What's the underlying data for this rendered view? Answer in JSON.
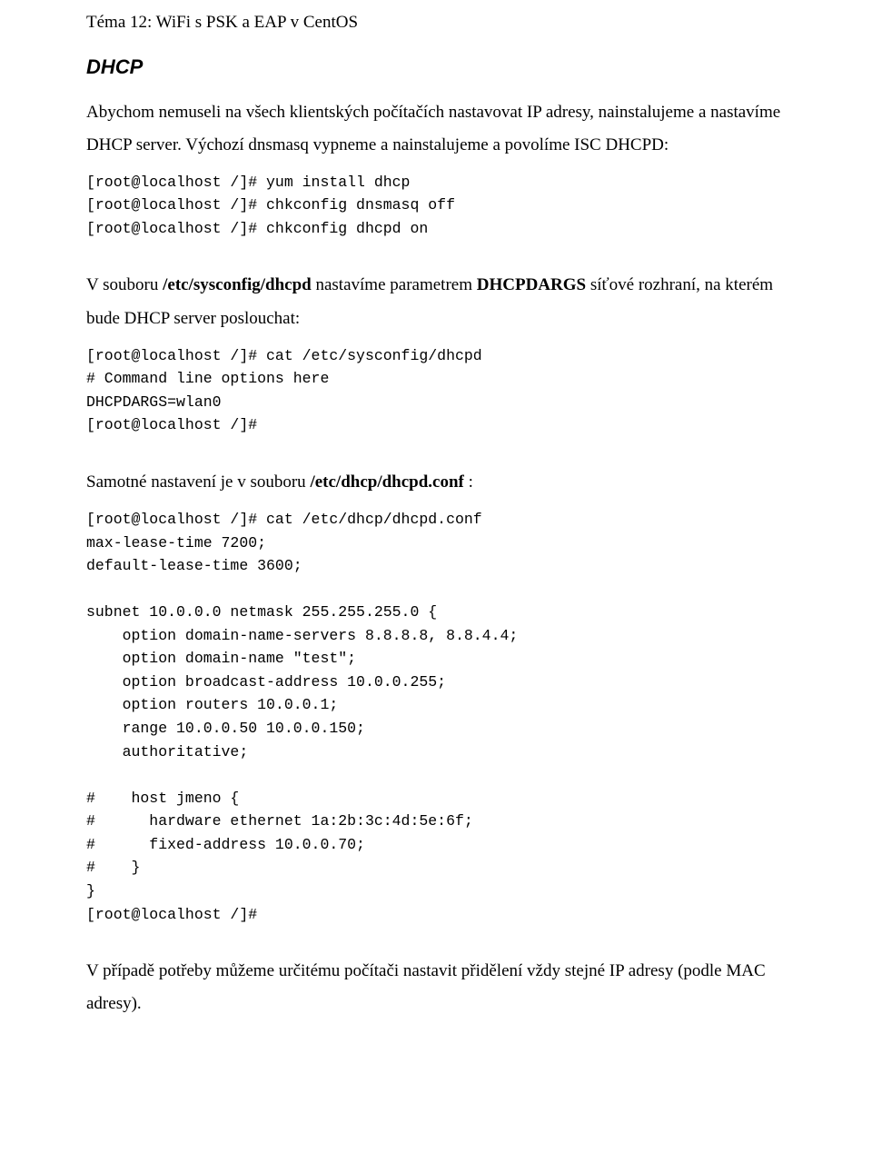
{
  "header": "Téma 12: WiFi s PSK a EAP v CentOS",
  "subtitle": "DHCP",
  "para1": "Abychom nemuseli na všech klientských počítačích nastavovat IP adresy, nainstalujeme a nastavíme DHCP server. Výchozí dnsmasq vypneme a nainstalujeme a povolíme ISC DHCPD:",
  "code1": "[root@localhost /]# yum install dhcp\n[root@localhost /]# chkconfig dnsmasq off\n[root@localhost /]# chkconfig dhcpd on",
  "para2_pre": "V souboru ",
  "para2_bold1": "/etc/sysconfig/dhcpd",
  "para2_mid": " nastavíme parametrem ",
  "para2_bold2": "DHCPDARGS",
  "para2_post": " síťové rozhraní, na kterém bude DHCP server poslouchat:",
  "code2": "[root@localhost /]# cat /etc/sysconfig/dhcpd\n# Command line options here\nDHCPDARGS=wlan0\n[root@localhost /]#",
  "para3_pre": "Samotné nastavení je v souboru ",
  "para3_bold": "/etc/dhcp/dhcpd.conf",
  "para3_post": " :",
  "code3": "[root@localhost /]# cat /etc/dhcp/dhcpd.conf\nmax-lease-time 7200;\ndefault-lease-time 3600;\n\nsubnet 10.0.0.0 netmask 255.255.255.0 {\n    option domain-name-servers 8.8.8.8, 8.8.4.4;\n    option domain-name \"test\";\n    option broadcast-address 10.0.0.255;\n    option routers 10.0.0.1;\n    range 10.0.0.50 10.0.0.150;\n    authoritative;\n\n#    host jmeno {\n#      hardware ethernet 1a:2b:3c:4d:5e:6f;\n#      fixed-address 10.0.0.70;\n#    }\n}\n[root@localhost /]#",
  "para4": "V případě potřeby můžeme určitému počítači nastavit přidělení vždy stejné IP adresy (podle MAC adresy)."
}
